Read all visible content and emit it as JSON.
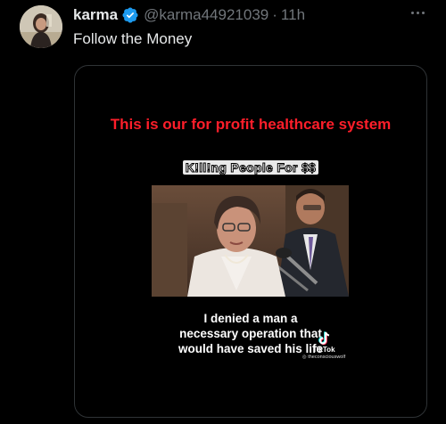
{
  "tweet": {
    "display_name": "karma",
    "handle": "@karma44921039",
    "separator": "·",
    "time": "11h",
    "text": "Follow the Money"
  },
  "media": {
    "headline": "This is our for profit healthcare system",
    "banner": "K!ll!ng People For $$",
    "caption": "I denied a man a necessary operation that would have saved his life",
    "watermark_brand": "TikTok",
    "watermark_user": "theconsciouswolf"
  },
  "icons": {
    "verified": "verified-badge-icon",
    "more": "more-options-icon",
    "tiktok": "tiktok-logo-icon"
  },
  "colors": {
    "background": "#000000",
    "verified": "#1d9bf0",
    "headline": "#ff1e2a",
    "secondary_text": "#71767b"
  }
}
